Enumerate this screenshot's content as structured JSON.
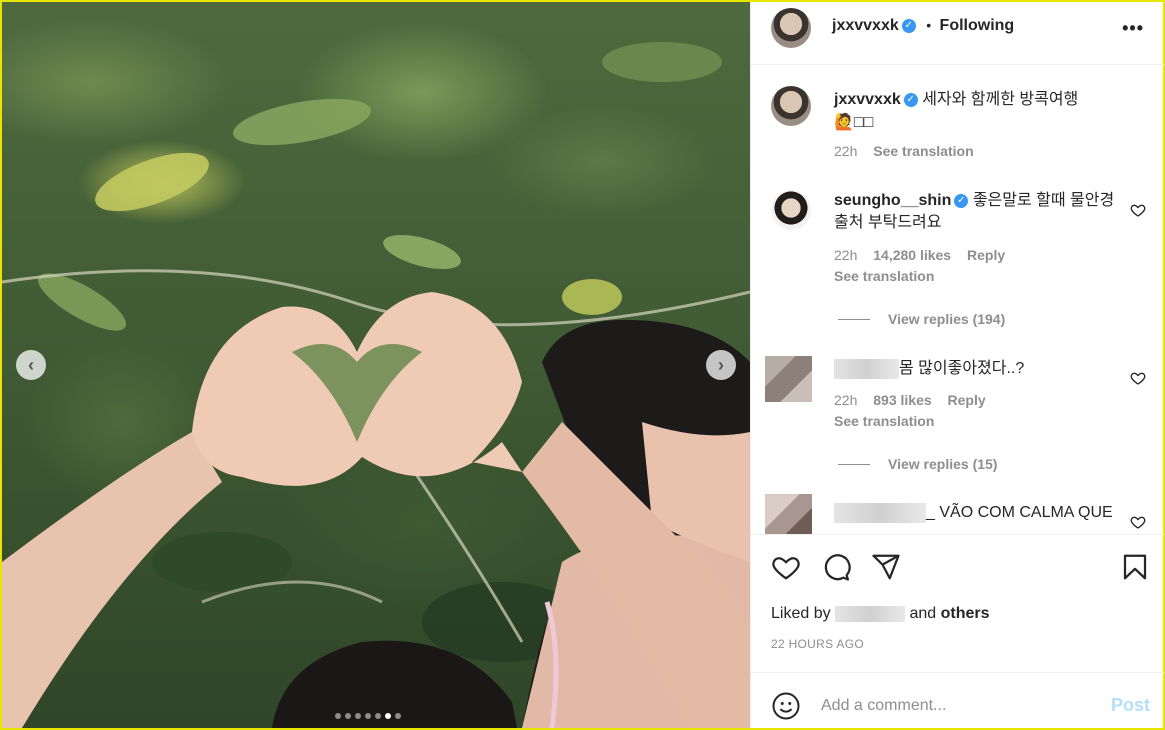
{
  "post": {
    "username": "jxxvvxxk",
    "following_label": "Following",
    "separator": "•"
  },
  "caption": {
    "username": "jxxvvxxk",
    "text": "세자와 함께한 방콕여행",
    "emoji": "🙋□□",
    "time": "22h",
    "see_translation": "See translation"
  },
  "comments": [
    {
      "username": "seungho__shin",
      "verified": true,
      "text": "좋은말로 할때 물안경 출처 부탁드려요",
      "time": "22h",
      "likes": "14,280 likes",
      "reply": "Reply",
      "see_translation": "See translation",
      "view_replies": "View replies (194)"
    },
    {
      "username": "",
      "text": "몸 많이좋아졌다..?",
      "time": "22h",
      "likes": "893 likes",
      "reply": "Reply",
      "see_translation": "See translation",
      "view_replies": "View replies (15)"
    },
    {
      "username": "",
      "text": "_ VÃO COM CALMA QUE"
    }
  ],
  "footer": {
    "liked_by": "Liked by",
    "and": "and",
    "others": "others",
    "time_ago": "22 HOURS AGO",
    "add_comment_placeholder": "Add a comment...",
    "post_label": "Post"
  },
  "carousel": {
    "count": 7,
    "active": 6
  },
  "colors": {
    "verified": "#3897f0",
    "post_disabled": "#b2dffc",
    "frame": "#e6e600"
  },
  "icons": [
    "chevron-left-icon",
    "chevron-right-icon",
    "more-options-icon",
    "heart-icon",
    "comment-icon",
    "share-icon",
    "bookmark-icon",
    "emoji-icon"
  ]
}
